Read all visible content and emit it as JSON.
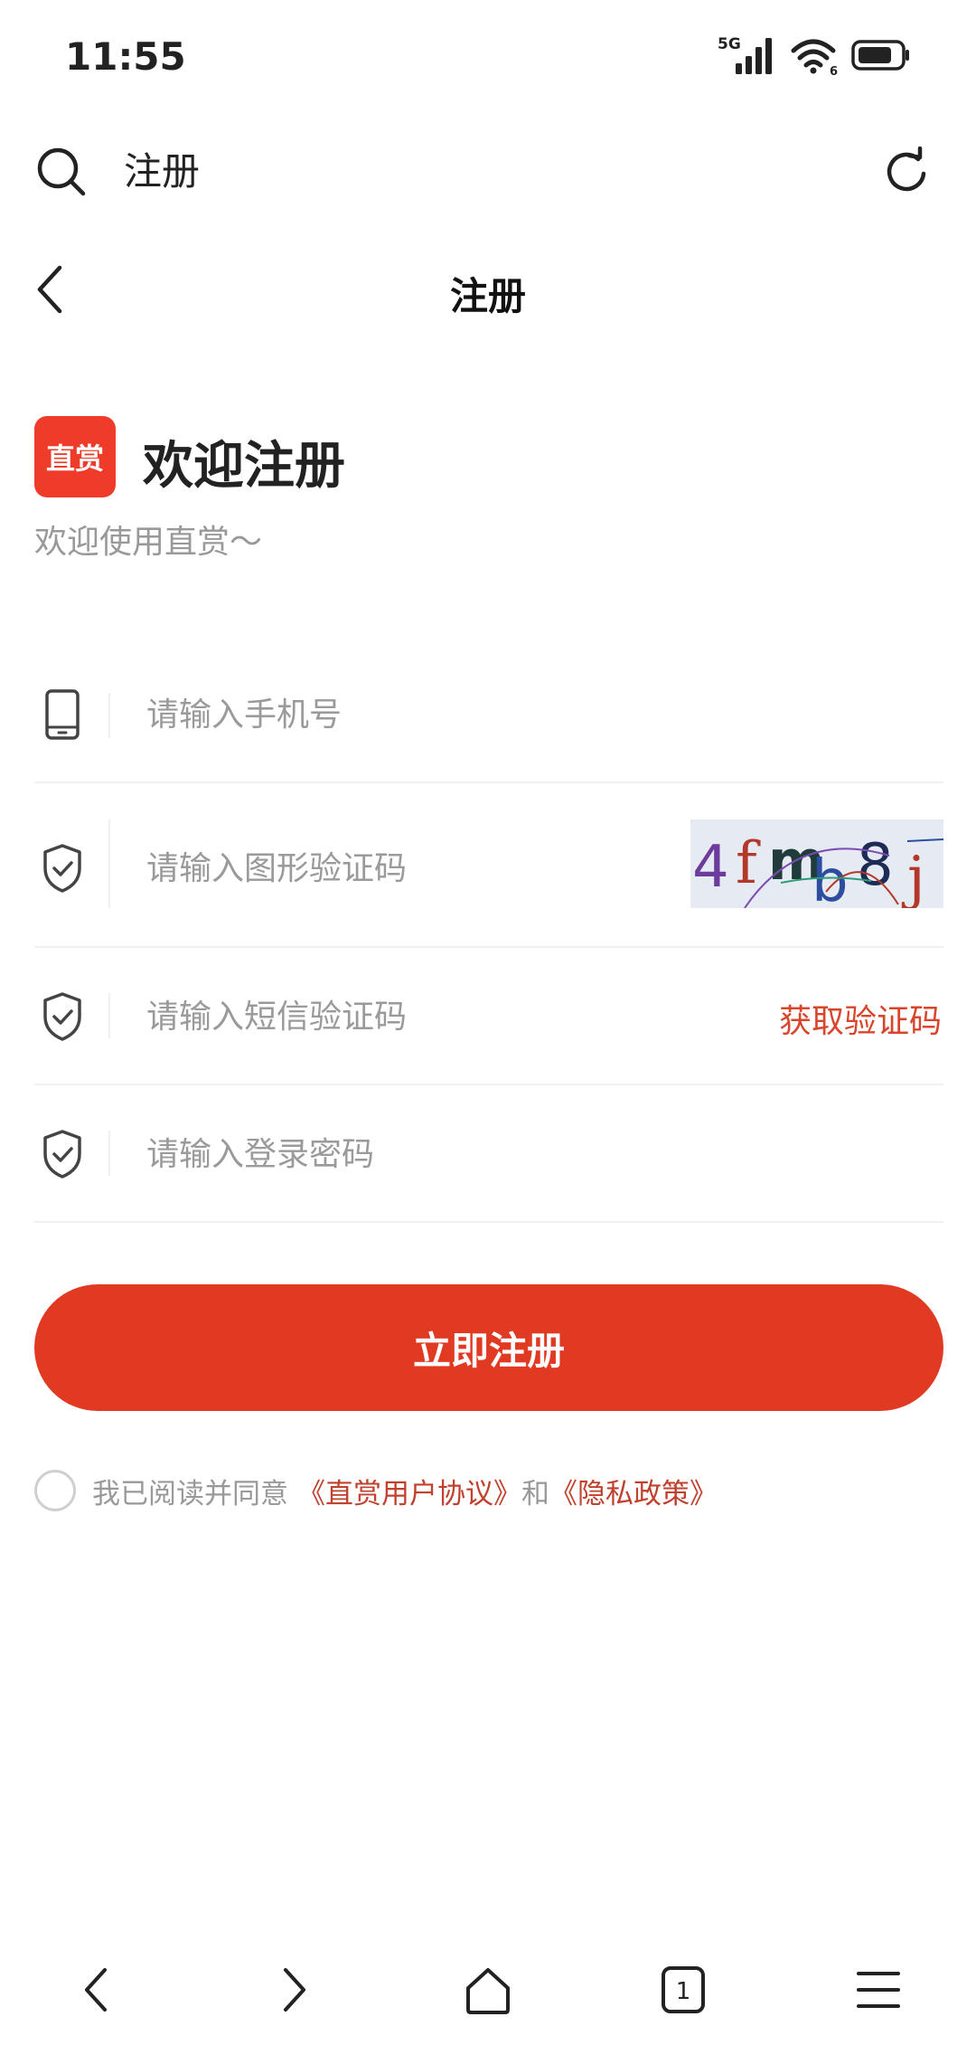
{
  "status_bar": {
    "time": "11:55",
    "network": "5G",
    "wifi_badge": "6"
  },
  "browser": {
    "address_text": "注册"
  },
  "nav": {
    "title": "注册"
  },
  "welcome": {
    "logo_text": "直赏",
    "title": "欢迎注册",
    "subtitle": "欢迎使用直赏～"
  },
  "form": {
    "phone": {
      "placeholder": "请输入手机号",
      "icon": "phone-icon"
    },
    "captcha": {
      "placeholder": "请输入图形验证码",
      "icon": "shield-check-icon",
      "captcha_text": "4fmb8j"
    },
    "sms": {
      "placeholder": "请输入短信验证码",
      "icon": "shield-check-icon",
      "action_label": "获取验证码"
    },
    "password": {
      "placeholder": "请输入登录密码",
      "icon": "shield-check-icon"
    }
  },
  "submit": {
    "label": "立即注册"
  },
  "agreement": {
    "prefix": "我已阅读并同意",
    "user_agreement": "《直赏用户协议》",
    "and": "和",
    "privacy_policy": "《隐私政策》"
  },
  "bottom_nav": {
    "tab_count": "1"
  },
  "colors": {
    "accent": "#e03a23",
    "link": "#c0412e",
    "placeholder": "#9a9a9a"
  }
}
